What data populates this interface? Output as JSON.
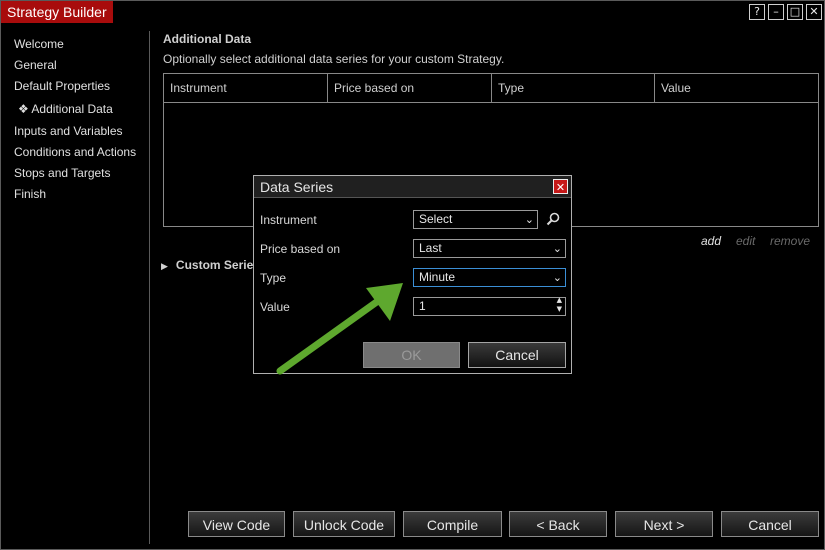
{
  "window": {
    "title": "Strategy Builder",
    "controls": {
      "help": "?",
      "minimize": "–",
      "maximize": "□",
      "close": "✕"
    }
  },
  "sidebar": {
    "items": [
      {
        "label": "Welcome"
      },
      {
        "label": "General"
      },
      {
        "label": "Default Properties"
      },
      {
        "label": "❖ Additional Data",
        "selected": true
      },
      {
        "label": "Inputs and Variables"
      },
      {
        "label": "Conditions and Actions"
      },
      {
        "label": "Stops and Targets"
      },
      {
        "label": "Finish"
      }
    ]
  },
  "main": {
    "title": "Additional Data",
    "subtitle": "Optionally select additional data series for your custom Strategy.",
    "grid": {
      "columns": [
        "Instrument",
        "Price based on",
        "Type",
        "Value"
      ],
      "rows": []
    },
    "actions": {
      "add": "add",
      "edit": "edit",
      "remove": "remove"
    },
    "custom_series": "Custom Series"
  },
  "dialog": {
    "title": "Data Series",
    "instrument_label": "Instrument",
    "instrument_value": "Select",
    "price_label": "Price based on",
    "price_value": "Last",
    "type_label": "Type",
    "type_value": "Minute",
    "value_label": "Value",
    "value_value": "1",
    "ok": "OK",
    "cancel": "Cancel"
  },
  "footer": {
    "view_code": "View Code",
    "unlock_code": "Unlock Code",
    "compile": "Compile",
    "back": "< Back",
    "next": "Next >",
    "cancel": "Cancel"
  },
  "colors": {
    "accent": "#a80c0c",
    "annotation_arrow": "#5ea82e",
    "focus": "#3b8fd6"
  }
}
